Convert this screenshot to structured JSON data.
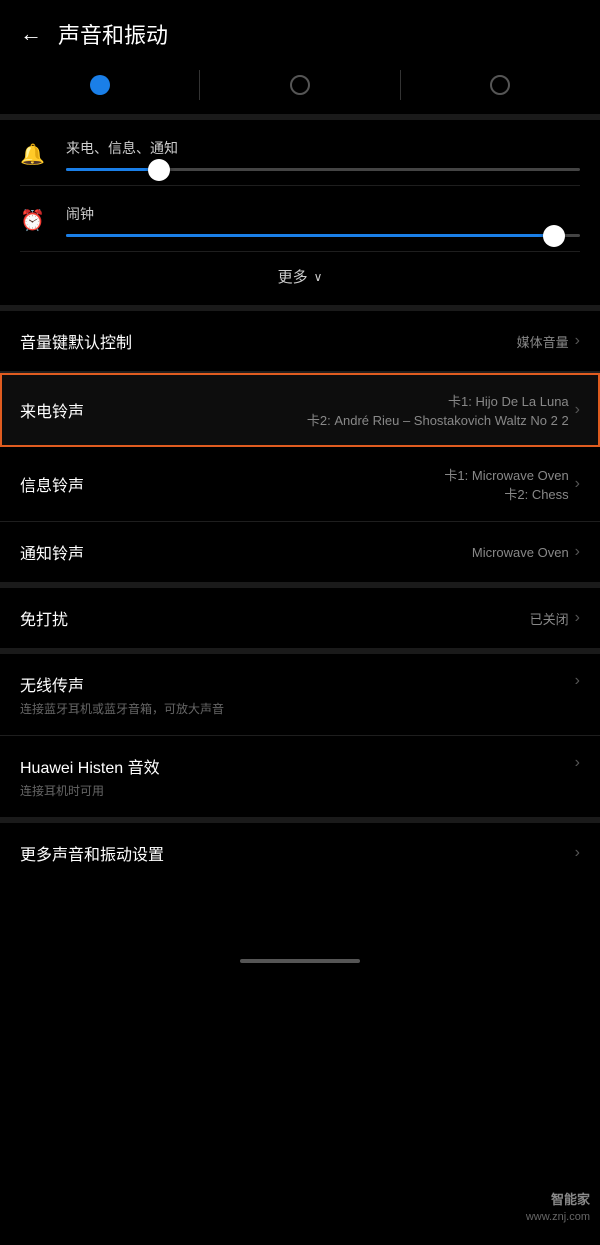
{
  "header": {
    "back_label": "←",
    "title": "声音和振动"
  },
  "tabs": [
    {
      "id": "tab1",
      "state": "active"
    },
    {
      "id": "tab2",
      "state": "inactive"
    },
    {
      "id": "tab3",
      "state": "inactive"
    }
  ],
  "volume_section": {
    "ringtone": {
      "label": "来电、信息、通知",
      "icon": "🔔",
      "fill_percent": 18
    },
    "alarm": {
      "label": "闹钟",
      "icon": "⏰",
      "fill_percent": 95
    },
    "more_label": "更多",
    "chevron_down": "∨"
  },
  "settings": [
    {
      "id": "volume-key-default",
      "label": "音量键默认控制",
      "value_line1": "媒体音量",
      "value_line2": "",
      "highlighted": false
    },
    {
      "id": "ringtone",
      "label": "来电铃声",
      "value_line1": "卡1: Hijo De La Luna",
      "value_line2": "卡2: André Rieu – Shostakovich Waltz No 2 2",
      "highlighted": true
    },
    {
      "id": "message-tone",
      "label": "信息铃声",
      "value_line1": "卡1: Microwave Oven",
      "value_line2": "卡2: Chess",
      "highlighted": false
    },
    {
      "id": "notification-tone",
      "label": "通知铃声",
      "value_line1": "Microwave Oven",
      "value_line2": "",
      "highlighted": false
    }
  ],
  "dnd": {
    "label": "免打扰",
    "value": "已关闭"
  },
  "wireless": {
    "label": "无线传声",
    "sublabel": "连接蓝牙耳机或蓝牙音箱，可放大声音"
  },
  "histen": {
    "label": "Huawei Histen 音效",
    "sublabel": "连接耳机时可用"
  },
  "more_settings": {
    "label": "更多声音和振动设置"
  },
  "watermark": {
    "line1": "智能家",
    "line2": "www.znj.com"
  }
}
